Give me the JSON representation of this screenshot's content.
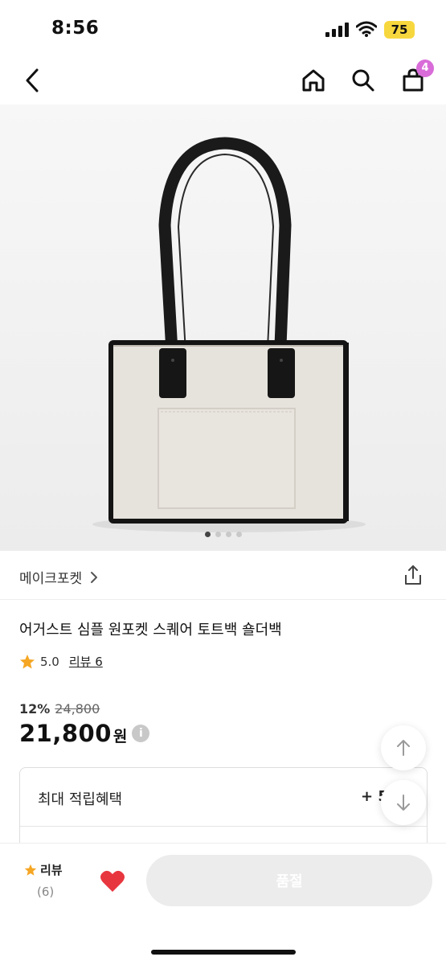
{
  "status_bar": {
    "time": "8:56",
    "battery": "75"
  },
  "nav": {
    "cart_count": "4"
  },
  "product": {
    "brand": "메이크포켓",
    "title": "어거스트 심플 원포켓 스퀘어 토트백 숄더백",
    "rating": "5.0",
    "review_link": "리뷰 6",
    "discount_rate": "12%",
    "original_price": "24,800",
    "price": "21,800",
    "currency": "원",
    "image_dots": {
      "count": 4,
      "active": 0
    }
  },
  "benefit": {
    "label": "최대 적립혜택",
    "value": "+ 5"
  },
  "bottom_bar": {
    "review_label": "리뷰",
    "review_count": "(6)",
    "soldout_label": "품절"
  },
  "colors": {
    "accent_badge": "#d96cd9",
    "star": "#f5a623",
    "heart": "#e8363f",
    "battery": "#f7d73e"
  }
}
